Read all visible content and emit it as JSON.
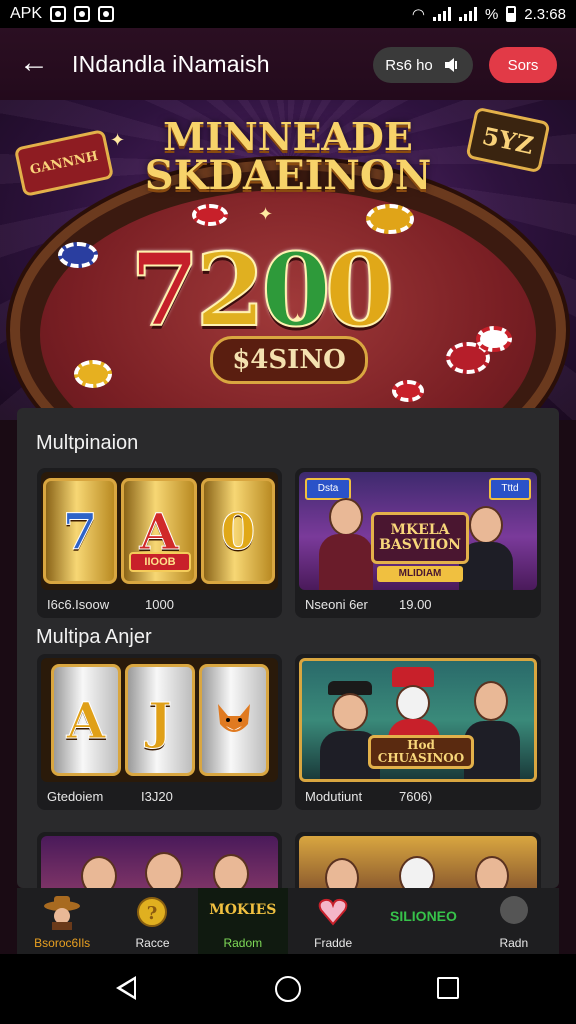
{
  "status_bar": {
    "carrier": "APK",
    "percent": "%",
    "time": "2.3:68"
  },
  "header": {
    "title": "INdandla iNamaish",
    "pill_label": "Rs6 ho",
    "pill_icon": "sound-icon",
    "action_label": "Sors"
  },
  "hero": {
    "title_line1": "MINNEADE",
    "title_line2": "SKDAEINON",
    "number": [
      "7",
      "2",
      "0",
      "0"
    ],
    "plaque": "$4SINO",
    "badge_left": "GANNNH",
    "badge_right": "5YZ"
  },
  "sections": [
    {
      "title": "Multpinaion",
      "cards": [
        {
          "title": "",
          "caption": "I6c6.Isoow",
          "value": "1000",
          "art": "gold-slot-reels",
          "reel_symbols": [
            "7",
            "A",
            "0"
          ],
          "reel_banner": "IIOOB"
        },
        {
          "title": "MKELA BASVIION",
          "subtitle": "MLIDIAM",
          "caption": "Nseoni 6er",
          "value": "19.00",
          "art": "casino-characters",
          "tag_left": "Dsta",
          "tag_right": "Tttd"
        }
      ]
    },
    {
      "title": "Multipa Anjer",
      "cards": [
        {
          "title": "",
          "caption": "Gtedoiem",
          "value": "I3J20",
          "art": "silver-slot-reels",
          "reel_symbols": [
            "A",
            "J",
            "fox"
          ]
        },
        {
          "title": "Hod CHUASINOO",
          "caption": "Modutiunt",
          "value": "7606)",
          "art": "gangster-characters"
        }
      ]
    }
  ],
  "bottom_nav": [
    {
      "label": "Bsoroc6Ils",
      "icon": "cowboy-icon",
      "color": "#e8a020"
    },
    {
      "label": "Racce",
      "icon": "coin-icon",
      "color": "#ffffff"
    },
    {
      "label": "Radom",
      "badge": "MOKIES",
      "icon": "movies-icon",
      "color": "#7ed957"
    },
    {
      "label": "Fradde",
      "icon": "heart-icon",
      "color": "#ffffff"
    },
    {
      "label": "",
      "badge": "SILIONEO",
      "icon": "slots-icon",
      "color": "#37c24a"
    },
    {
      "label": "Radn",
      "icon": "profile-icon",
      "color": "#ffffff"
    }
  ]
}
